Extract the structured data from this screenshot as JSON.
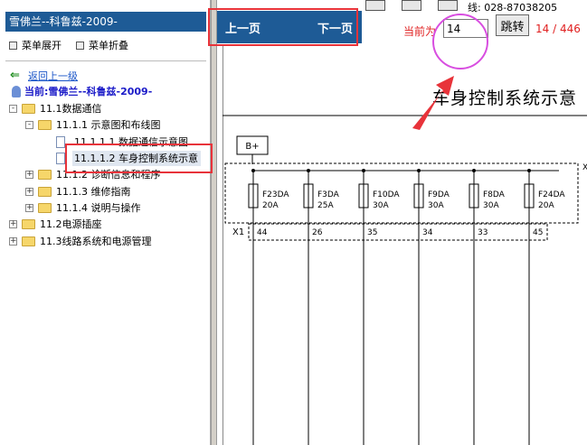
{
  "left_panel": {
    "title": "雪佛兰--科鲁兹-2009-",
    "expand_label": "菜单展开",
    "collapse_label": "菜单折叠",
    "back_label": "返回上一级",
    "current_label": "当前:雪佛兰--科鲁兹-2009-",
    "tree": [
      {
        "label": "11.1数据通信",
        "toggle": "-"
      },
      {
        "label": "11.1.1 示意图和布线图",
        "toggle": "-"
      },
      {
        "label": "11.1.1.1 数据通信示意图"
      },
      {
        "label": "11.1.1.2 车身控制系统示意"
      },
      {
        "label": "11.1.2 诊断信息和程序",
        "toggle": "+"
      },
      {
        "label": "11.1.3 维修指南",
        "toggle": "+"
      },
      {
        "label": "11.1.4 说明与操作",
        "toggle": "+"
      },
      {
        "label": "11.2电源插座",
        "toggle": "+"
      },
      {
        "label": "11.3线路系统和电源管理",
        "toggle": "+"
      }
    ]
  },
  "toolbar": {
    "prev_label": "上一页",
    "next_label": "下一页",
    "current_page_label": "当前为",
    "page_value": "14",
    "jump_label": "跳转",
    "page_count": "14 / 446",
    "phone_fragment": "线: 028-87038205"
  },
  "document": {
    "title": "车身控制系统示意",
    "bplus": "B+",
    "connector_left": "X1",
    "connector_right_fragment": "X",
    "fuses": [
      {
        "name": "F23DA",
        "rating": "20A",
        "pin": "44"
      },
      {
        "name": "F3DA",
        "rating": "25A",
        "pin": "26"
      },
      {
        "name": "F10DA",
        "rating": "30A",
        "pin": "35"
      },
      {
        "name": "F9DA",
        "rating": "30A",
        "pin": "34"
      },
      {
        "name": "F8DA",
        "rating": "30A",
        "pin": "33"
      },
      {
        "name": "F24DA",
        "rating": "20A",
        "pin": "45"
      }
    ]
  },
  "colors": {
    "header_blue": "#1e5b96",
    "annotation_red": "#e8333a",
    "annotation_magenta": "#d84ee0",
    "text_red": "#e02020"
  }
}
